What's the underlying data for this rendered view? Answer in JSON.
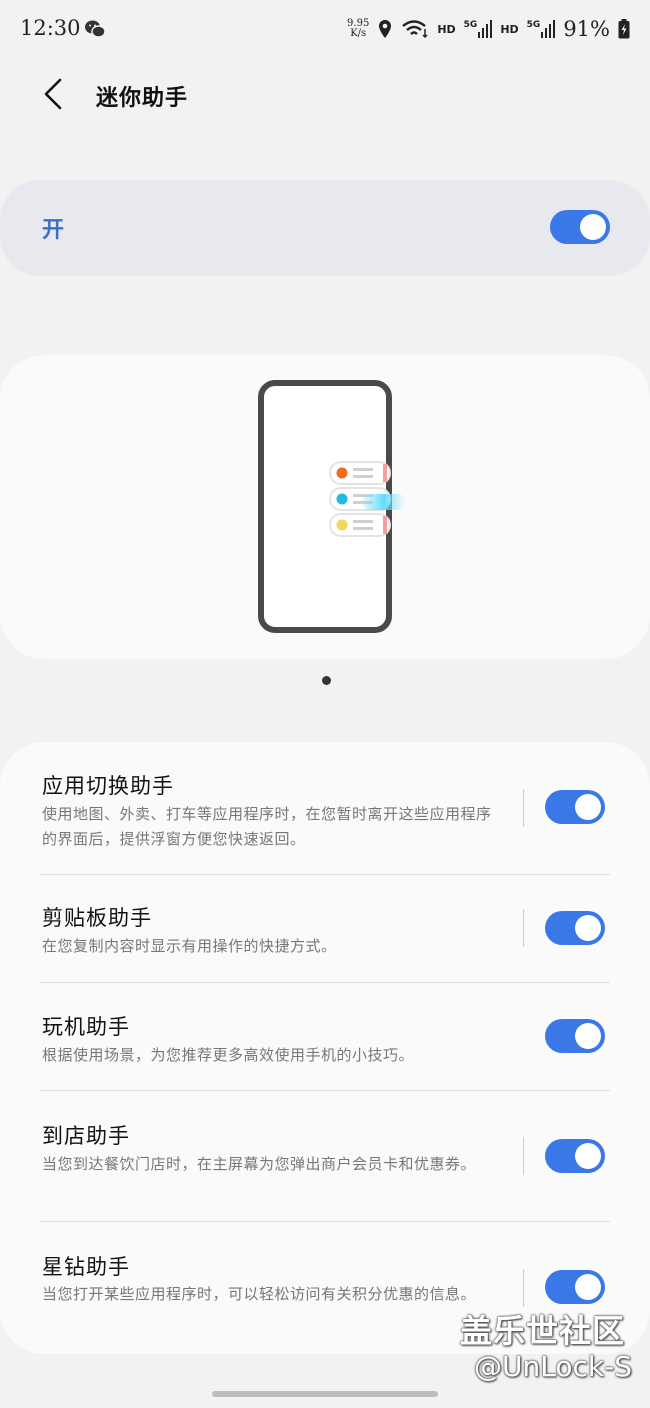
{
  "status_bar": {
    "time": "12:30",
    "net_speed_value": "9.95",
    "net_speed_unit": "K/s",
    "hd1": "HD",
    "net5g1": "5G",
    "hd2": "HD",
    "net5g2": "5G",
    "battery": "91%"
  },
  "header": {
    "title": "迷你助手"
  },
  "master": {
    "label": "开",
    "enabled": true
  },
  "carousel": {
    "page_count": 1,
    "current_page": 1
  },
  "items": [
    {
      "title": "应用切换助手",
      "desc": "使用地图、外卖、打车等应用程序时，在您暂时离开这些应用程序的界面后，提供浮窗方便您快速返回。",
      "enabled": true
    },
    {
      "title": "剪贴板助手",
      "desc": "在您复制内容时显示有用操作的快捷方式。",
      "enabled": true
    },
    {
      "title": "玩机助手",
      "desc": "根据使用场景，为您推荐更多高效使用手机的小技巧。",
      "enabled": true
    },
    {
      "title": "到店助手",
      "desc": "当您到达餐饮门店时，在主屏幕为您弹出商户会员卡和优惠券。",
      "enabled": true
    },
    {
      "title": "星钻助手",
      "desc": "当您打开某些应用程序时，可以轻松访问有关积分优惠的信息。",
      "enabled": true
    }
  ],
  "watermark": {
    "line1": "盖乐世社区",
    "line2": "@UnLock-S"
  },
  "colors": {
    "accent": "#3b78e7",
    "master_label": "#3e6ec3"
  }
}
